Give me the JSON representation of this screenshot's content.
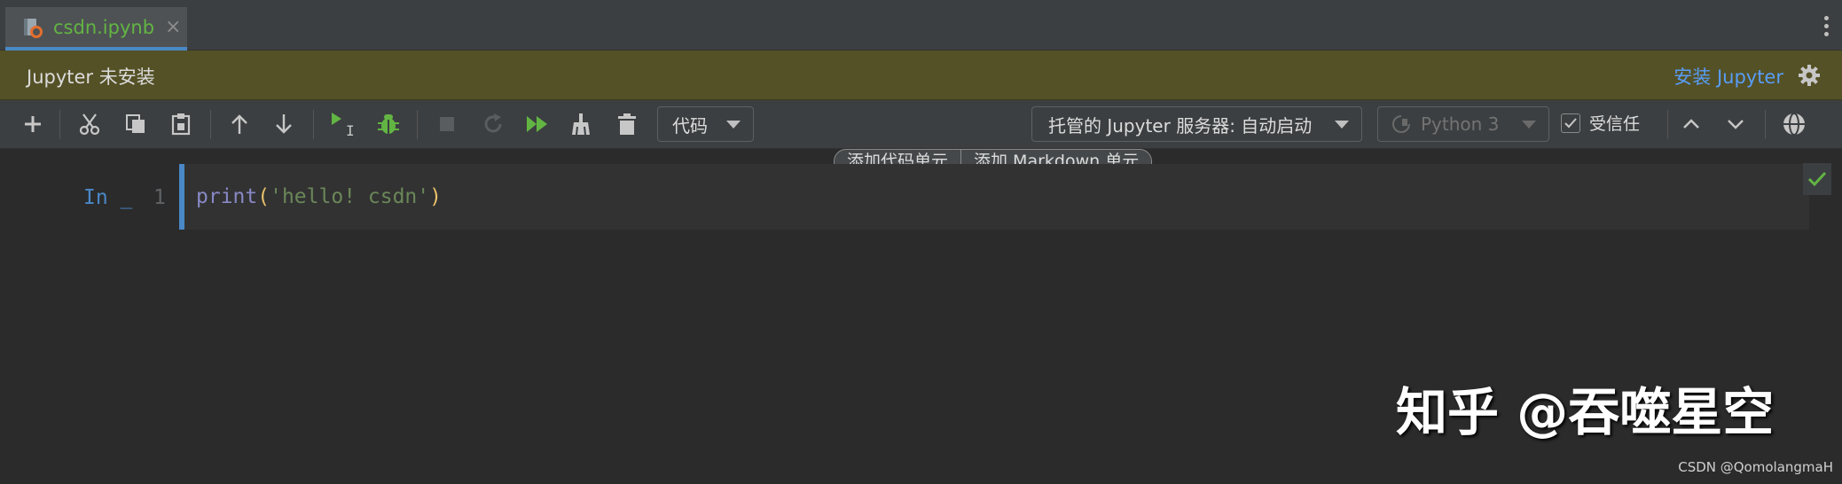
{
  "tab": {
    "filename": "csdn.ipynb",
    "close": "×"
  },
  "banner": {
    "message": "Jupyter 未安装",
    "install_link": "安装 Jupyter"
  },
  "toolbar": {
    "cell_type": "代码",
    "server": "托管的 Jupyter 服务器: 自动启动",
    "kernel": "Python 3",
    "trusted": "受信任"
  },
  "cell_actions": {
    "add_code": "添加代码单元",
    "add_markdown": "添加 Markdown 单元"
  },
  "cell": {
    "prompt": "In _",
    "line_number": "1",
    "code": {
      "fn": "print",
      "open": "(",
      "string": "'hello! csdn'",
      "close": ")"
    }
  },
  "watermark": "知乎 @吞噬星空",
  "credit": "CSDN @QomolangmaH",
  "colors": {
    "accent": "#4a88c7",
    "run": "#62b543",
    "banner": "#545126",
    "link": "#589df6"
  }
}
